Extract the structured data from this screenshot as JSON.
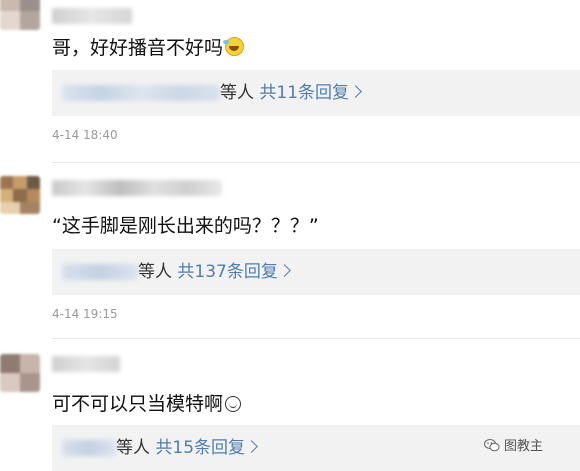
{
  "comments": [
    {
      "text": "哥，好好播音不好吗",
      "emoji": "laughing-tears-icon",
      "reply_suffix": "等人",
      "reply_count_label": "共11条回复",
      "time": "4-14 18:40"
    },
    {
      "text": "“这手脚是刚长出来的吗？？？”",
      "emoji": "",
      "reply_suffix": "等人",
      "reply_count_label": "共137条回复",
      "time": "4-14 19:15"
    },
    {
      "text": "可不可以只当模特啊",
      "emoji": "smile-icon",
      "reply_suffix": "等人",
      "reply_count_label": "共15条回复",
      "time": ""
    }
  ],
  "watermark": {
    "label": "图教主",
    "icon": "wechat-icon"
  },
  "colors": {
    "link": "#507daf",
    "reply_bg": "#f2f2f2",
    "time": "#9a9a9a"
  }
}
